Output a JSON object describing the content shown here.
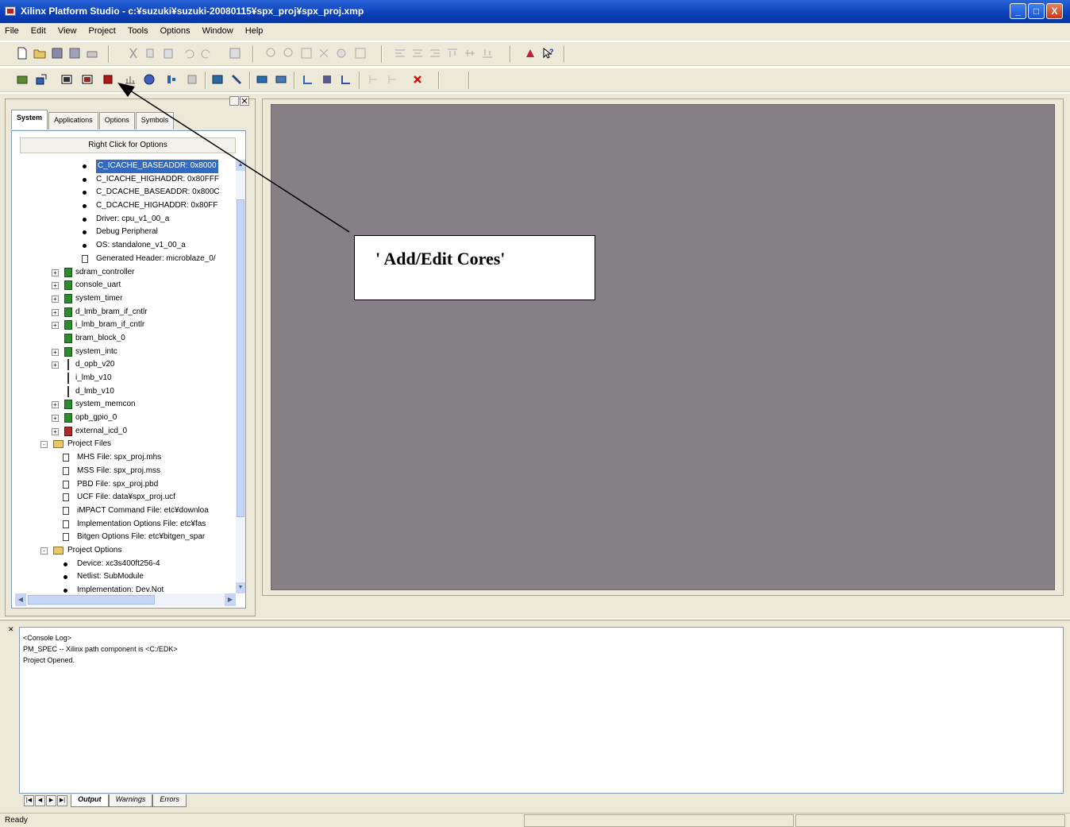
{
  "window": {
    "title": "Xilinx Platform Studio - c:¥suzuki¥suzuki-20080115¥spx_proj¥spx_proj.xmp",
    "buttons": [
      "_",
      "□",
      "X"
    ]
  },
  "menu": [
    "File",
    "Edit",
    "View",
    "Project",
    "Tools",
    "Options",
    "Window",
    "Help"
  ],
  "left_panel": {
    "tabs": [
      "System",
      "Applications",
      "Options",
      "Symbols"
    ],
    "active_tab": "System",
    "right_click_hint": "Right Click for Options",
    "tree": [
      {
        "label": "C_ICACHE_BASEADDR: 0x8000",
        "icon": "bullet",
        "selected": true
      },
      {
        "label": "C_ICACHE_HIGHADDR: 0x80FFF",
        "icon": "bullet"
      },
      {
        "label": "C_DCACHE_BASEADDR: 0x800C",
        "icon": "bullet"
      },
      {
        "label": "C_DCACHE_HIGHADDR: 0x80FF",
        "icon": "bullet"
      },
      {
        "label": "Driver: cpu_v1_00_a",
        "icon": "bullet"
      },
      {
        "label": "Debug Peripheral",
        "icon": "bullet"
      },
      {
        "label": "OS: standalone_v1_00_a",
        "icon": "bullet"
      },
      {
        "label": "Generated Header: microblaze_0/",
        "icon": "doc"
      },
      {
        "label": "sdram_controller",
        "icon": "chip",
        "expander": "+"
      },
      {
        "label": "console_uart",
        "icon": "chip",
        "expander": "+"
      },
      {
        "label": "system_timer",
        "icon": "chip",
        "expander": "+"
      },
      {
        "label": "d_lmb_bram_if_cntlr",
        "icon": "chip",
        "expander": "+"
      },
      {
        "label": "i_lmb_bram_if_cntlr",
        "icon": "chip",
        "expander": "+"
      },
      {
        "label": "bram_block_0",
        "icon": "chip"
      },
      {
        "label": "system_intc",
        "icon": "chip",
        "expander": "+"
      },
      {
        "label": "d_opb_v20",
        "icon": "bus",
        "expander": "+"
      },
      {
        "label": "i_lmb_v10",
        "icon": "bus"
      },
      {
        "label": "d_lmb_v10",
        "icon": "bus"
      },
      {
        "label": "system_memcon",
        "icon": "chip",
        "expander": "+"
      },
      {
        "label": "opb_gpio_0",
        "icon": "chip",
        "expander": "+"
      },
      {
        "label": "external_icd_0",
        "icon": "chip-red",
        "expander": "+"
      },
      {
        "label": "Project Files",
        "icon": "folder",
        "expander": "-"
      },
      {
        "label": "MHS File: spx_proj.mhs",
        "icon": "doc"
      },
      {
        "label": "MSS File: spx_proj.mss",
        "icon": "doc"
      },
      {
        "label": "PBD File: spx_proj.pbd",
        "icon": "doc"
      },
      {
        "label": "UCF File: data¥spx_proj.ucf",
        "icon": "doc"
      },
      {
        "label": "iMPACT Command File: etc¥downloa",
        "icon": "doc"
      },
      {
        "label": "Implementation Options File: etc¥fas",
        "icon": "doc"
      },
      {
        "label": "Bitgen Options File: etc¥bitgen_spar",
        "icon": "doc"
      },
      {
        "label": "Project Options",
        "icon": "folder",
        "expander": "-"
      },
      {
        "label": "Device: xc3s400ft256-4",
        "icon": "bullet"
      },
      {
        "label": "Netlist: SubModule",
        "icon": "bullet"
      },
      {
        "label": "Implementation: Dev.Not",
        "icon": "bullet"
      }
    ]
  },
  "callout": {
    "text": "' Add/Edit Cores'"
  },
  "console": {
    "lines": [
      "<Console Log>",
      "PM_SPEC -- Xilinx path component is <C:/EDK>",
      "Project Opened."
    ],
    "tabs": [
      "Output",
      "Warnings",
      "Errors"
    ],
    "active_tab": "Output"
  },
  "status": {
    "text": "Ready"
  }
}
